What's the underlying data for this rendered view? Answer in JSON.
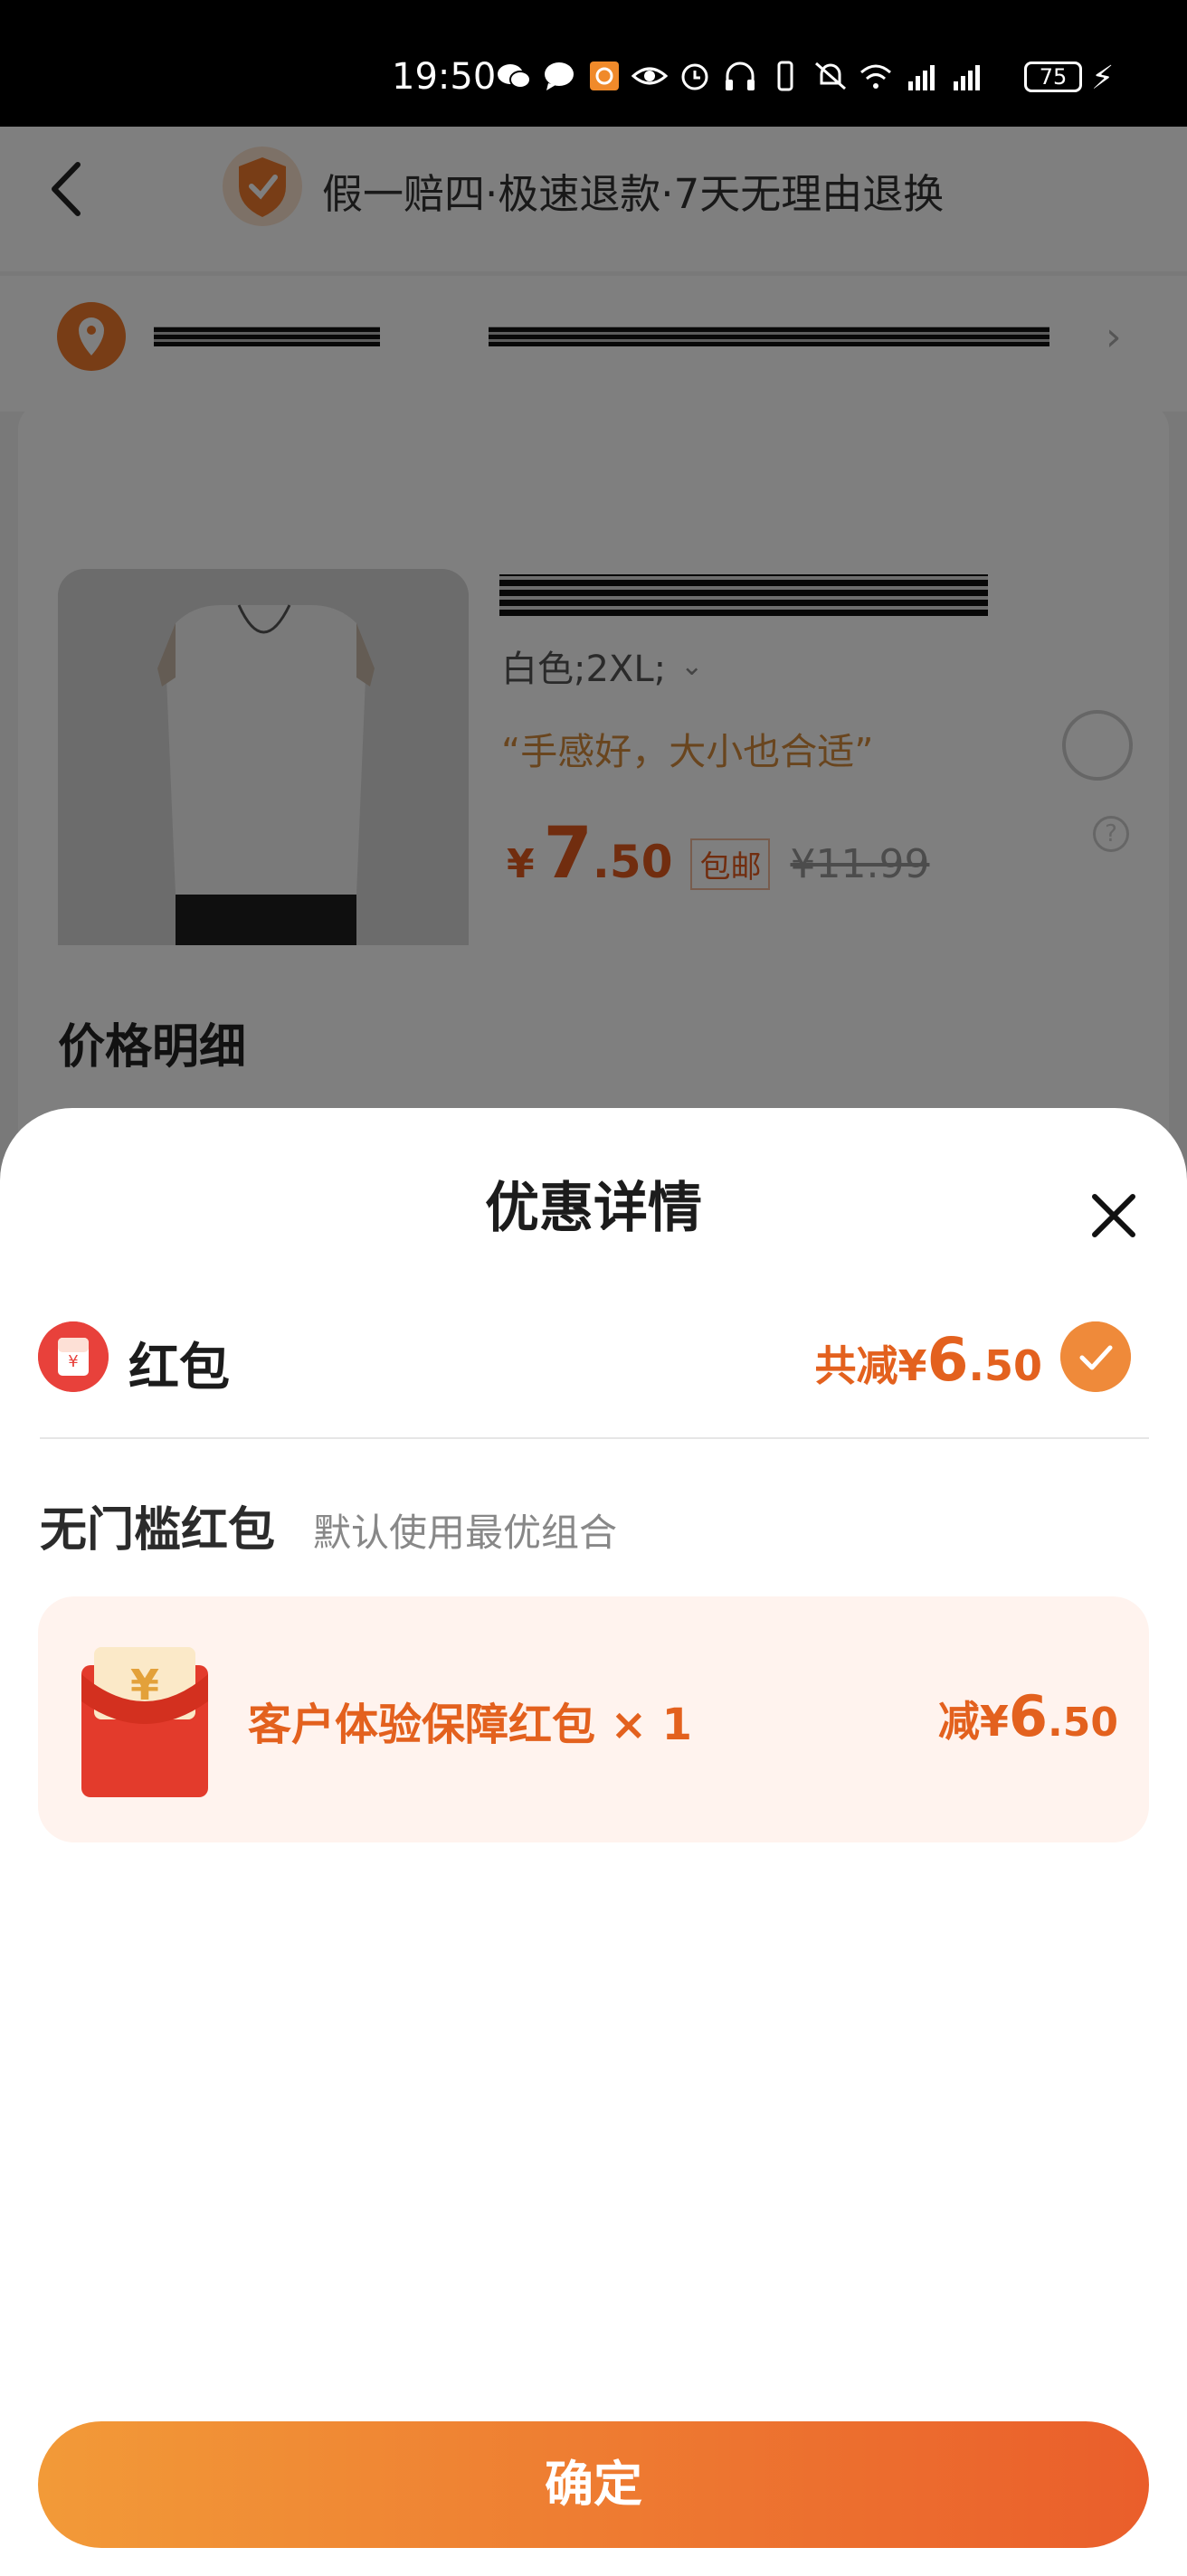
{
  "status_bar": {
    "time": "19:50",
    "battery": "75",
    "icons": [
      "wechat-icon",
      "message-icon",
      "app-icon",
      "eye-icon",
      "alarm-icon",
      "headphones-icon",
      "vibrate-icon",
      "mute-icon",
      "wifi-icon",
      "signal-5g-icon",
      "signal-5g-icon",
      "charging-icon"
    ]
  },
  "background_page": {
    "guarantee": "假一赔四·极速退款·7天无理由退换",
    "product": {
      "spec": "白色;2XL;",
      "review": "“手感好，大小也合适”",
      "price_currency": "¥",
      "price_int": "7",
      "price_dec": ".50",
      "shipping": "包邮",
      "original_price": "¥11.99"
    },
    "price_detail_title": "价格明细"
  },
  "sheet": {
    "title": "优惠详情",
    "red_packet": {
      "label": "红包",
      "total_prefix": "共减¥",
      "total_int": "6",
      "total_dec": ".50",
      "selected": true
    },
    "section": {
      "title": "无门槛红包",
      "subtitle": "默认使用最优组合"
    },
    "coupon": {
      "name": "客户体验保障红包 × 1",
      "amount_prefix": "减¥",
      "amount_int": "6",
      "amount_dec": ".50"
    },
    "confirm_label": "确定"
  },
  "colors": {
    "accent": "#e3611e",
    "button_gradient_start": "#f29a38",
    "button_gradient_end": "#ea5e2b",
    "coupon_bg": "#fff3ee"
  }
}
